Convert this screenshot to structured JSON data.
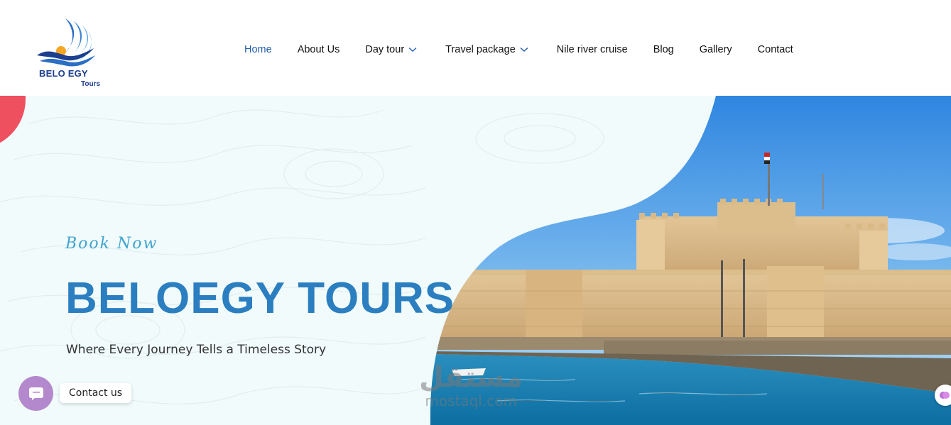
{
  "brand": {
    "name": "BELO EGY",
    "sub": "Tours"
  },
  "nav": {
    "items": [
      {
        "label": "Home",
        "active": true,
        "has_dropdown": false
      },
      {
        "label": "About Us",
        "active": false,
        "has_dropdown": false
      },
      {
        "label": "Day tour",
        "active": false,
        "has_dropdown": true
      },
      {
        "label": "Travel package",
        "active": false,
        "has_dropdown": true
      },
      {
        "label": "Nile river cruise",
        "active": false,
        "has_dropdown": false
      },
      {
        "label": "Blog",
        "active": false,
        "has_dropdown": false
      },
      {
        "label": "Gallery",
        "active": false,
        "has_dropdown": false
      },
      {
        "label": "Contact",
        "active": false,
        "has_dropdown": false
      }
    ]
  },
  "hero": {
    "kicker": "Book Now",
    "title": "BELOEGY TOURS",
    "subtitle": "Where Every Journey Tells a Timeless Story"
  },
  "contact_widget": {
    "label": "Contact us"
  },
  "watermark": {
    "arabic": "مستقل",
    "latin": "mostaql.com"
  },
  "colors": {
    "accent": "#1f5ea8",
    "title": "#2b7fc0",
    "kicker": "#3fa4cf",
    "hero_bg": "#f1fbfb",
    "chat": "#b488cd",
    "blob": "#ef5060"
  }
}
